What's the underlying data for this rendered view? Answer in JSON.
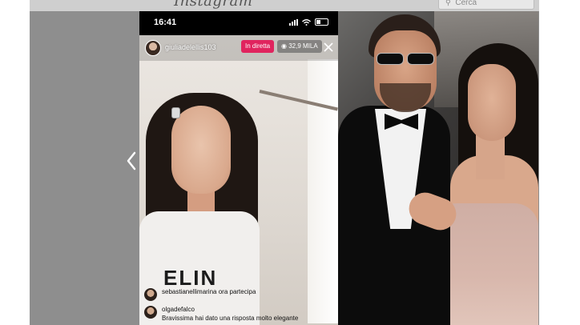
{
  "background": {
    "instagram_logo_text": "Instagram",
    "search_placeholder": "Cerca",
    "prev_icon": "chevron-left-icon"
  },
  "phone": {
    "status": {
      "time": "16:41"
    },
    "live": {
      "username": "giuliadelellis103",
      "live_badge": "In diretta",
      "viewer_count": "32,9 MILA",
      "close_icon": "close-icon"
    },
    "shirt_print": "ELIN",
    "comments": [
      {
        "user": "sebastianellimarina ora partecipa",
        "text": ""
      },
      {
        "user": "olgadefalco",
        "text": "Bravissima hai dato una risposta molto elegante"
      }
    ]
  },
  "colors": {
    "live_badge": "#e0245e",
    "backdrop": "#8e8e8e"
  }
}
